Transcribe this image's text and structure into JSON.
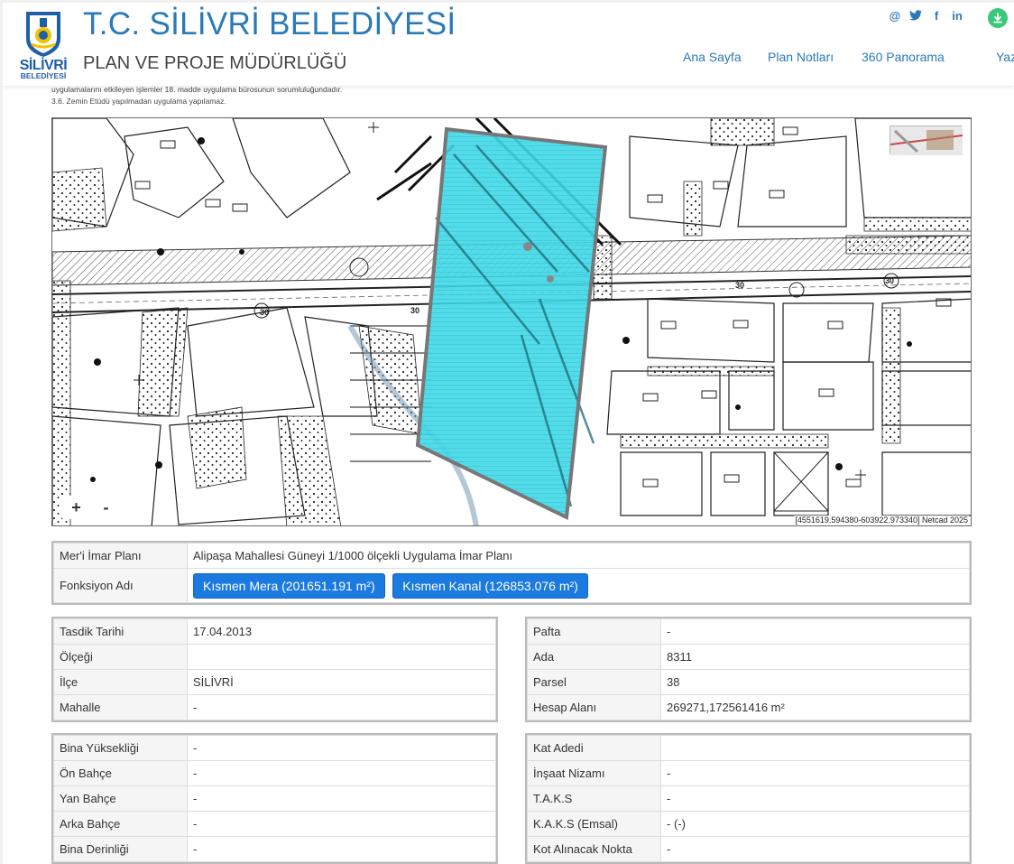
{
  "header": {
    "title": "T.C. SİLİVRİ BELEDİYESİ",
    "subtitle": "PLAN VE PROJE MÜDÜRLÜĞÜ",
    "logo_text": "SİLİVRİ",
    "logo_sub": "BELEDİYESİ",
    "social": {
      "at": "@",
      "facebook": "f",
      "linkedin": "in"
    }
  },
  "nav": [
    {
      "label": "Ana Sayfa"
    },
    {
      "label": "Plan Notları"
    },
    {
      "label": "360 Panorama"
    },
    {
      "label": "Yazdır"
    }
  ],
  "notes": {
    "line1": "uygulamalarını etkileyen işlemler 18. madde uygulama bürosunun sorumluluğundadır.",
    "line2": "3.6. Zemin Etüdü yapılmadan uygulama yapılamaz."
  },
  "map": {
    "zoom_in": "+",
    "zoom_out": "-",
    "coords": "[4551619.594380-603922.973340] Netcad 2025",
    "road_label": "30"
  },
  "plan": {
    "row1": {
      "label": "Mer'i İmar Planı",
      "value": "Alipaşa Mahallesi Güneyi 1/1000 ölçekli Uygulama İmar Planı"
    },
    "row2": {
      "label": "Fonksiyon Adı",
      "btn1": "Kısmen Mera (201651.191 m²)",
      "btn2": "Kısmen Kanal (126853.076 m²)"
    }
  },
  "left1": [
    {
      "label": "Tasdik Tarihi",
      "value": "17.04.2013"
    },
    {
      "label": "Ölçeği",
      "value": ""
    },
    {
      "label": "İlçe",
      "value": "SİLİVRİ"
    },
    {
      "label": "Mahalle",
      "value": "-"
    }
  ],
  "right1": [
    {
      "label": "Pafta",
      "value": "-"
    },
    {
      "label": "Ada",
      "value": "8311"
    },
    {
      "label": "Parsel",
      "value": "38"
    },
    {
      "label": "Hesap Alanı",
      "value": "269271,172561416 m²"
    }
  ],
  "left2": [
    {
      "label": "Bina Yüksekliği",
      "value": "-"
    },
    {
      "label": "Ön Bahçe",
      "value": "-"
    },
    {
      "label": "Yan Bahçe",
      "value": "-"
    },
    {
      "label": "Arka Bahçe",
      "value": "-"
    },
    {
      "label": "Bina Derinliği",
      "value": "-"
    }
  ],
  "right2": [
    {
      "label": "Kat Adedi",
      "value": ""
    },
    {
      "label": "İnşaat Nizamı",
      "value": "-"
    },
    {
      "label": "T.A.K.S",
      "value": "-"
    },
    {
      "label": "K.A.K.S (Emsal)",
      "value": "- (-)"
    },
    {
      "label": "Kot Alınacak Nokta",
      "value": "-"
    }
  ],
  "colors": {
    "brand": "#2a7ab8",
    "parcel": "#3fd8e8",
    "button": "#1a7ae0",
    "download": "#3cc87a"
  }
}
